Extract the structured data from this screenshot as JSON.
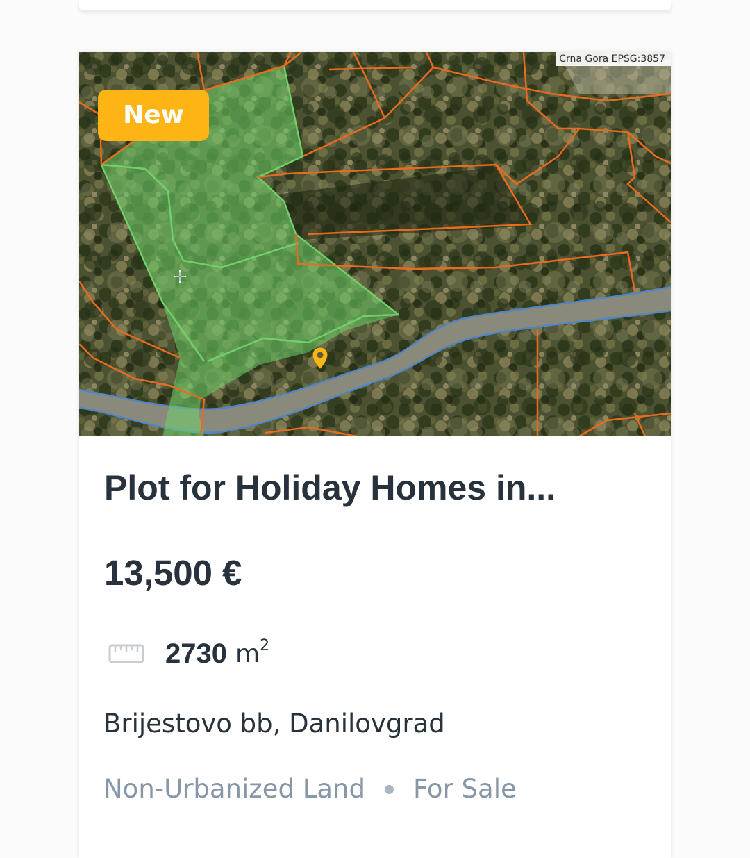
{
  "listing": {
    "badge": "New",
    "map_attribution": "Crna Gora EPSG:3857",
    "title": "Plot for Holiday Homes in...",
    "price": "13,500 €",
    "area_value": "2730",
    "area_unit": "m",
    "area_unit_exponent": "2",
    "address": "Brijestovo bb, Danilovgrad",
    "land_type": "Non-Urbanized Land",
    "offer_type": "For Sale"
  },
  "icons": {
    "area": "ruler-icon",
    "map_marker": "location-pin-icon",
    "map_crosshair": "crosshair-icon"
  },
  "colors": {
    "badge_bg": "#fdb415",
    "title_text": "#27323c",
    "muted_text": "#8797a8",
    "parcel_outline": "#ea6a1e",
    "selected_parcel": "#6fd16a",
    "road_outline": "#4f86c8"
  }
}
